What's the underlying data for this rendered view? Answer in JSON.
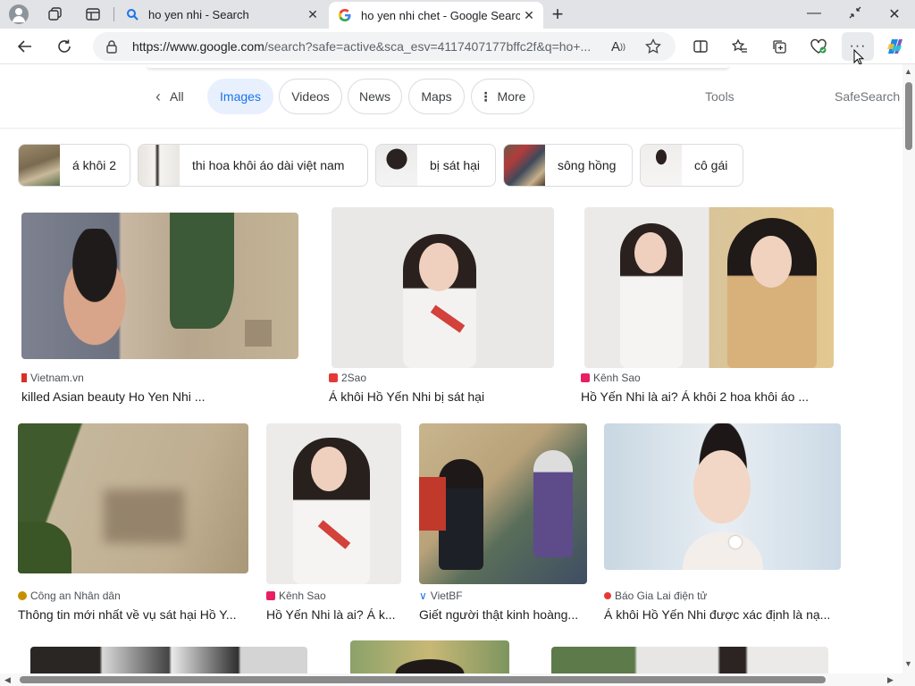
{
  "tabs": [
    {
      "title": "ho yen nhi - Search",
      "favicon": "search-icon"
    },
    {
      "title": "ho yen nhi chet - Google Search",
      "favicon": "google-icon"
    }
  ],
  "toolbar": {
    "url_host": "https://www.google.com",
    "url_rest": "/search?safe=active&sca_esv=4117407177bffc2f&q=ho+..."
  },
  "filters": {
    "back_label": "All",
    "items": [
      "Images",
      "Videos",
      "News",
      "Maps",
      "More"
    ],
    "selected": "Images",
    "tools": "Tools",
    "safesearch": "SafeSearch"
  },
  "related": [
    "á khôi 2",
    "thi hoa khôi áo dài việt nam",
    "bị sát hại",
    "sông hồng",
    "cô gái"
  ],
  "results": [
    {
      "source": "Vietnam.vn",
      "caption": "killed Asian beauty Ho Yen Nhi ..."
    },
    {
      "source": "2Sao",
      "caption": "Á khôi Hồ Yến Nhi bị sát hại"
    },
    {
      "source": "Kênh Sao",
      "caption": "Hồ Yến Nhi là ai? Á khôi 2 hoa khôi áo ..."
    },
    {
      "source": "Công an Nhân dân",
      "caption": "Thông tin mới nhất về vụ sát hại Hồ Y..."
    },
    {
      "source": "Kênh Sao",
      "caption": "Hồ Yến Nhi là ai? Á k..."
    },
    {
      "source": "VietBF",
      "caption": "Giết người thật kinh hoàng..."
    },
    {
      "source": "Báo Gia Lai điện tử",
      "caption": "Á khôi Hồ Yến Nhi được xác định là nạ..."
    }
  ],
  "colors": {
    "accent": "#1a73e8",
    "selected_chip_bg": "#e8f0fe",
    "tabstrip_bg": "#e1e3e6"
  }
}
